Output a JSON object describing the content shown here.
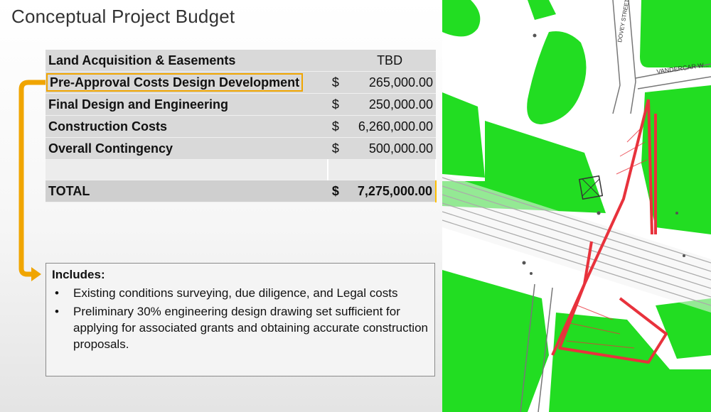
{
  "title": "Conceptual Project Budget",
  "budget": {
    "rows": [
      {
        "label": "Land Acquisition & Easements",
        "currency": "",
        "amount": "TBD"
      },
      {
        "label": "Pre-Approval Costs Design Development",
        "currency": "$",
        "amount": "265,000.00"
      },
      {
        "label": "Final Design and Engineering",
        "currency": "$",
        "amount": "250,000.00"
      },
      {
        "label": "Construction Costs",
        "currency": "$",
        "amount": "6,260,000.00"
      },
      {
        "label": "Overall Contingency",
        "currency": "$",
        "amount": "500,000.00"
      }
    ],
    "total": {
      "label": "TOTAL",
      "currency": "$",
      "amount": "7,275,000.00"
    }
  },
  "includes": {
    "heading": "Includes:",
    "items": [
      "Existing conditions surveying, due diligence, and Legal costs",
      "Preliminary 30% engineering design drawing set sufficient for applying for associated grants and obtaining accurate construction proposals."
    ]
  },
  "map": {
    "labels": [
      "DOVEY STREET",
      "VANDERCAR W..."
    ]
  },
  "colors": {
    "highlight": "#f0a500",
    "map_green": "#22dd22",
    "map_red": "#e8323c"
  }
}
